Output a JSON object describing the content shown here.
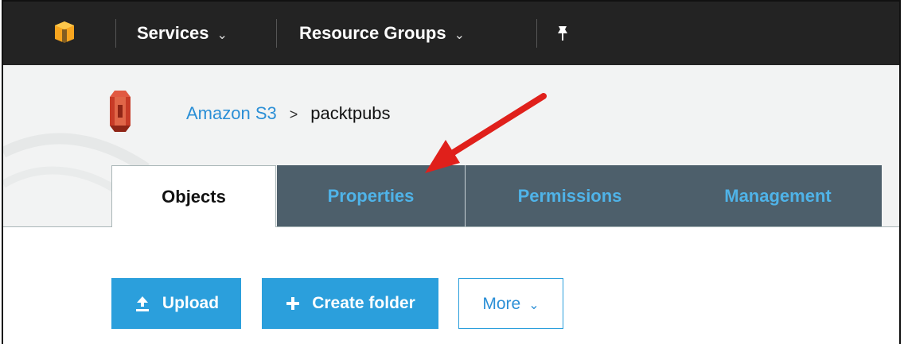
{
  "topnav": {
    "services_label": "Services",
    "resource_groups_label": "Resource Groups"
  },
  "breadcrumb": {
    "root": "Amazon S3",
    "separator": ">",
    "current": "packtpubs"
  },
  "tabs": [
    {
      "label": "Objects",
      "active": true
    },
    {
      "label": "Properties",
      "active": false
    },
    {
      "label": "Permissions",
      "active": false
    },
    {
      "label": "Management",
      "active": false
    }
  ],
  "actions": {
    "upload_label": "Upload",
    "create_folder_label": "Create folder",
    "more_label": "More"
  },
  "icons": [
    "aws-logo-icon",
    "chevron-down-icon",
    "pin-icon",
    "s3-logo-icon",
    "upload-icon",
    "plus-icon"
  ],
  "colors": {
    "topnav_bg": "#232323",
    "link": "#2b8fd6",
    "primary_button": "#2b9fdc",
    "tab_inactive_bg": "#4d5f6b",
    "tab_inactive_text": "#4fb3e8",
    "annotation_arrow": "#e0201b"
  }
}
